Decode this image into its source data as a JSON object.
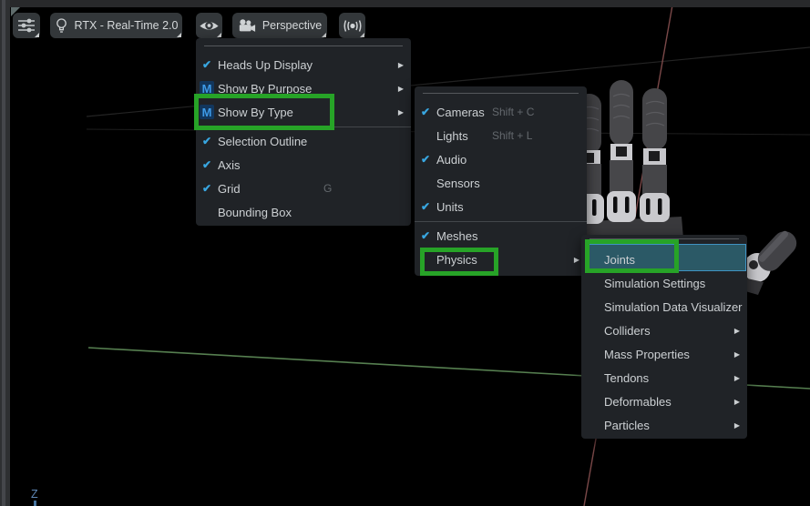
{
  "glyphs": {
    "check": "✔",
    "submenu_arrow": "▶",
    "purpose_icon": "M"
  },
  "toolbar": {
    "render_engine_button": {
      "label": "RTX - Real-Time 2.0"
    },
    "camera_button": {
      "label": "Perspective"
    }
  },
  "menus": {
    "visibility": {
      "items": [
        {
          "label": "Heads Up Display",
          "checked": true,
          "submenu": true
        },
        {
          "label": "Show By Purpose",
          "icon": "M",
          "submenu": true
        },
        {
          "label": "Show By Type",
          "icon": "M",
          "submenu": true,
          "annotated": true
        },
        {
          "label": "Selection Outline",
          "checked": true
        },
        {
          "label": "Axis",
          "checked": true
        },
        {
          "label": "Grid",
          "checked": true,
          "shortcut": "G"
        },
        {
          "label": "Bounding Box"
        }
      ]
    },
    "show_by_type": {
      "items": [
        {
          "label": "Cameras",
          "checked": true,
          "shortcut": "Shift + C"
        },
        {
          "label": "Lights",
          "shortcut": "Shift + L"
        },
        {
          "label": "Audio",
          "checked": true
        },
        {
          "label": "Sensors"
        },
        {
          "label": "Units",
          "checked": true
        },
        {
          "label": "Meshes",
          "checked": true
        },
        {
          "label": "Physics",
          "submenu": true,
          "annotated": true
        }
      ]
    },
    "physics": {
      "items": [
        {
          "label": "Joints",
          "highlighted": true,
          "annotated": true
        },
        {
          "label": "Simulation Settings"
        },
        {
          "label": "Simulation Data Visualizer"
        },
        {
          "label": "Colliders",
          "submenu": true
        },
        {
          "label": "Mass Properties",
          "submenu": true
        },
        {
          "label": "Tendons",
          "submenu": true
        },
        {
          "label": "Deformables",
          "submenu": true
        },
        {
          "label": "Particles",
          "submenu": true
        }
      ]
    }
  },
  "viewport": {
    "axis_gizmo_label": "Z"
  },
  "colors": {
    "annotation_green": "#27a327",
    "check_blue": "#38a6e0",
    "highlight_teal": "#2b5966",
    "highlight_border": "#3f93c2"
  }
}
